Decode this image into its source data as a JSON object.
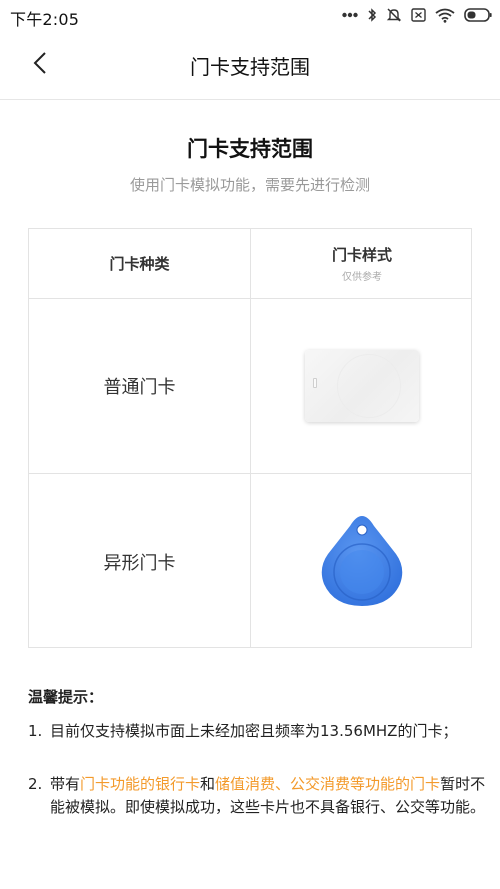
{
  "status_bar": {
    "time": "下午2:05",
    "icons": [
      "more-dots-icon",
      "bluetooth-icon",
      "mute-icon",
      "sim-icon",
      "wifi-icon",
      "battery-icon"
    ]
  },
  "nav": {
    "back_icon": "chevron-left-icon",
    "title": "门卡支持范围"
  },
  "page": {
    "title": "门卡支持范围",
    "subtitle": "使用门卡模拟功能，需要先进行检测"
  },
  "table": {
    "header": {
      "type_label": "门卡种类",
      "style_label": "门卡样式",
      "style_note": "仅供参考"
    },
    "rows": [
      {
        "label": "普通门卡",
        "image": "white-card-image"
      },
      {
        "label": "异形门卡",
        "image": "blue-keyfob-image"
      }
    ]
  },
  "tips": {
    "title": "温馨提示：",
    "items": [
      {
        "num": "1.",
        "text": "目前仅支持模拟市面上未经加密且频率为13.56MHZ的门卡；"
      },
      {
        "num": "2.",
        "prefix": "带有",
        "highlight1": "门卡功能的银行卡",
        "middle": "和",
        "highlight2": "储值消费、公交消费等功能的门卡",
        "suffix": "暂时不能被模拟。即使模拟成功，这些卡片也不具备银行、公交等功能。"
      }
    ]
  },
  "colors": {
    "highlight": "#f39a2b",
    "keyfob": "#3d7fe8",
    "divider": "#e3e3e3",
    "subtitle": "#9a9a9a"
  }
}
